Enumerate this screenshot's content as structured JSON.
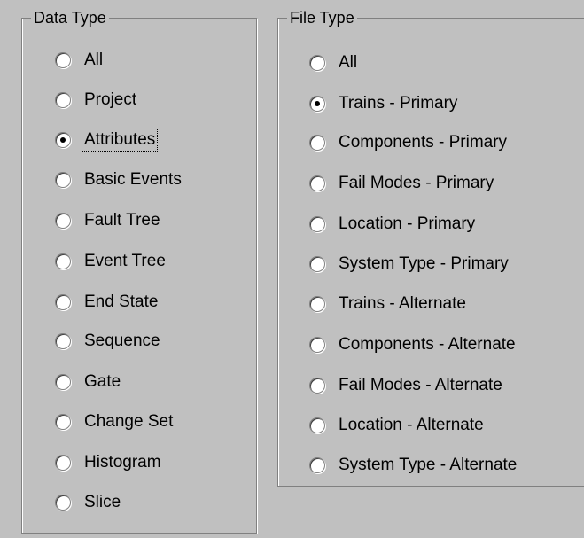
{
  "data_type": {
    "title": "Data Type",
    "options": [
      {
        "label": "All",
        "checked": false
      },
      {
        "label": "Project",
        "checked": false
      },
      {
        "label": "Attributes",
        "checked": true,
        "focused": true
      },
      {
        "label": "Basic Events",
        "checked": false
      },
      {
        "label": "Fault Tree",
        "checked": false
      },
      {
        "label": "Event Tree",
        "checked": false
      },
      {
        "label": "End State",
        "checked": false
      },
      {
        "label": "Sequence",
        "checked": false
      },
      {
        "label": "Gate",
        "checked": false
      },
      {
        "label": "Change Set",
        "checked": false
      },
      {
        "label": "Histogram",
        "checked": false
      },
      {
        "label": "Slice",
        "checked": false
      }
    ]
  },
  "file_type": {
    "title": "File Type",
    "options": [
      {
        "label": "All",
        "checked": false
      },
      {
        "label": "Trains - Primary",
        "checked": true
      },
      {
        "label": "Components - Primary",
        "checked": false
      },
      {
        "label": "Fail Modes - Primary",
        "checked": false
      },
      {
        "label": "Location - Primary",
        "checked": false
      },
      {
        "label": "System Type - Primary",
        "checked": false
      },
      {
        "label": "Trains - Alternate",
        "checked": false
      },
      {
        "label": "Components - Alternate",
        "checked": false
      },
      {
        "label": "Fail Modes - Alternate",
        "checked": false
      },
      {
        "label": "Location - Alternate",
        "checked": false
      },
      {
        "label": "System Type - Alternate",
        "checked": false
      }
    ]
  }
}
